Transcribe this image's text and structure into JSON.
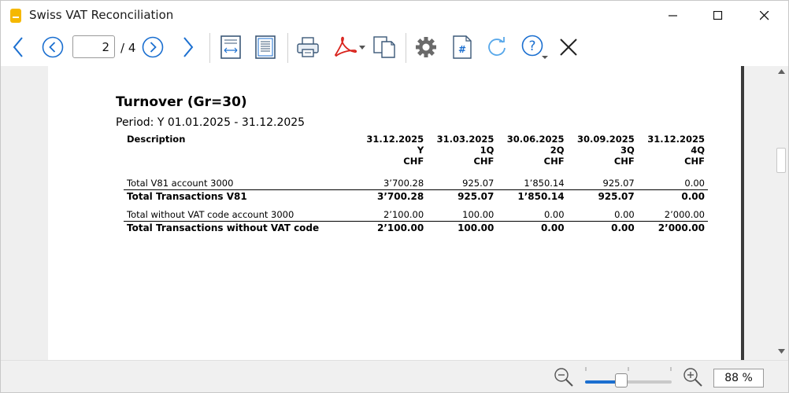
{
  "window": {
    "title": "Swiss VAT Reconciliation"
  },
  "toolbar": {
    "page_current": "2",
    "page_total": "/ 4"
  },
  "icons": {
    "nav": [
      "back-arrow-icon",
      "previous-page-icon",
      "next-page-icon",
      "forward-arrow-icon"
    ],
    "tools": [
      "fit-width-icon",
      "fit-page-icon",
      "print-icon",
      "pdf-icon",
      "copy-icon",
      "settings-icon",
      "page-number-icon",
      "refresh-icon",
      "help-icon",
      "close-icon"
    ],
    "zoom": [
      "zoom-out-icon",
      "zoom-in-icon"
    ]
  },
  "colors": {
    "accent": "#1b6fd0",
    "pdf_red": "#d9231c",
    "page": "#ffffff"
  },
  "report": {
    "title": "Turnover (Gr=30)",
    "period": "Period: Y 01.01.2025 - 31.12.2025",
    "columns": [
      {
        "label": "Description"
      },
      {
        "date": "31.12.2025",
        "period": "Y",
        "currency": "CHF"
      },
      {
        "date": "31.03.2025",
        "period": "1Q",
        "currency": "CHF"
      },
      {
        "date": "30.06.2025",
        "period": "2Q",
        "currency": "CHF"
      },
      {
        "date": "30.09.2025",
        "period": "3Q",
        "currency": "CHF"
      },
      {
        "date": "31.12.2025",
        "period": "4Q",
        "currency": "CHF"
      }
    ],
    "rows": [
      {
        "label": "Total V81 account 3000",
        "values": [
          "3’700.28",
          "925.07",
          "1’850.14",
          "925.07",
          "0.00"
        ]
      },
      {
        "label": "Total Transactions V81",
        "values": [
          "3’700.28",
          "925.07",
          "1’850.14",
          "925.07",
          "0.00"
        ]
      },
      {
        "label": "Total without VAT code account 3000",
        "values": [
          "2’100.00",
          "100.00",
          "0.00",
          "0.00",
          "2’000.00"
        ]
      },
      {
        "label": "Total Transactions without VAT code",
        "values": [
          "2’100.00",
          "100.00",
          "0.00",
          "0.00",
          "2’000.00"
        ]
      }
    ]
  },
  "zoom": {
    "value": "88 %",
    "level_fraction": 0.42
  }
}
